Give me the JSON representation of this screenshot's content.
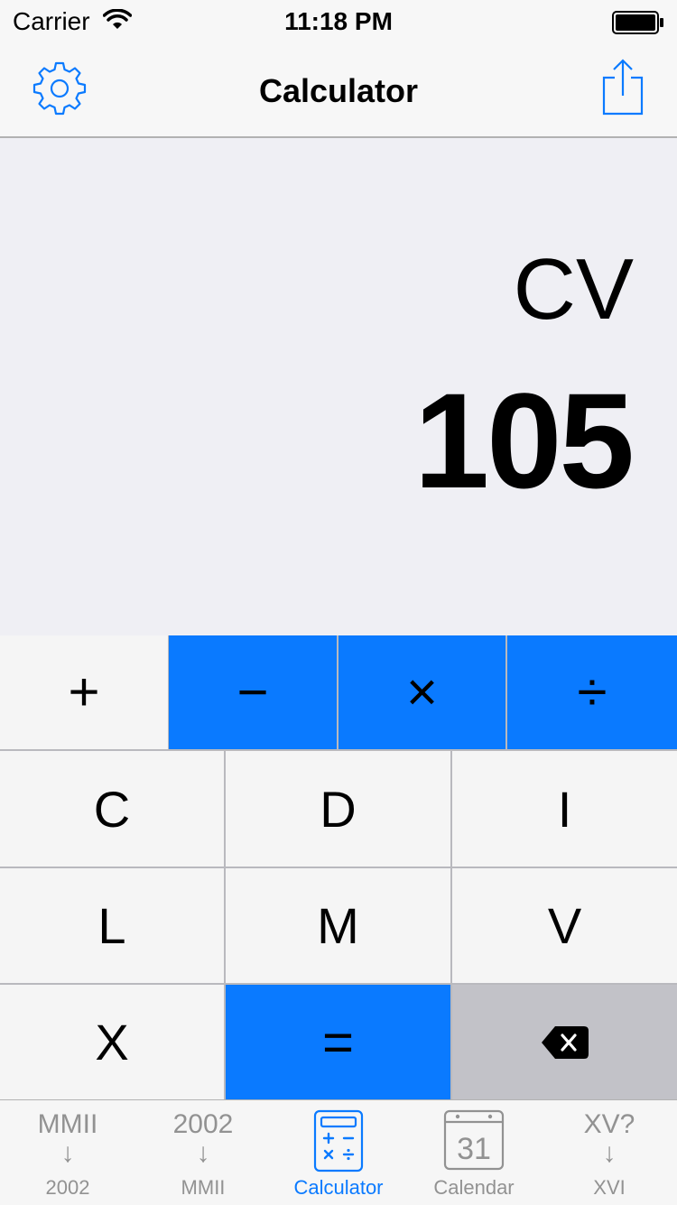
{
  "status_bar": {
    "carrier": "Carrier",
    "time": "11:18 PM"
  },
  "nav_bar": {
    "title": "Calculator",
    "left_icon": "gear-icon",
    "right_icon": "share-icon"
  },
  "display": {
    "roman": "CV",
    "arabic": "105"
  },
  "keypad": {
    "operators": [
      "+",
      "−",
      "×",
      "÷"
    ],
    "digits_row1": [
      "C",
      "D",
      "I"
    ],
    "digits_row2": [
      "L",
      "M",
      "V"
    ],
    "digit_x": "X",
    "equals": "=",
    "backspace_icon": "backspace-icon"
  },
  "tab_bar": {
    "tabs": [
      {
        "top": "MMII",
        "arrow": "↓",
        "label": "2002"
      },
      {
        "top": "2002",
        "arrow": "↓",
        "label": "MMII"
      },
      {
        "icon": "calculator-icon",
        "label": "Calculator"
      },
      {
        "icon": "calendar-icon",
        "icon_text": "31",
        "label": "Calendar"
      },
      {
        "top": "XV?",
        "arrow": "↓",
        "label": "XVI"
      }
    ]
  },
  "colors": {
    "accent": "#0a7aff",
    "display_bg": "#efeff4",
    "key_bg": "#f5f5f5",
    "backspace_bg": "#c2c2c8"
  }
}
